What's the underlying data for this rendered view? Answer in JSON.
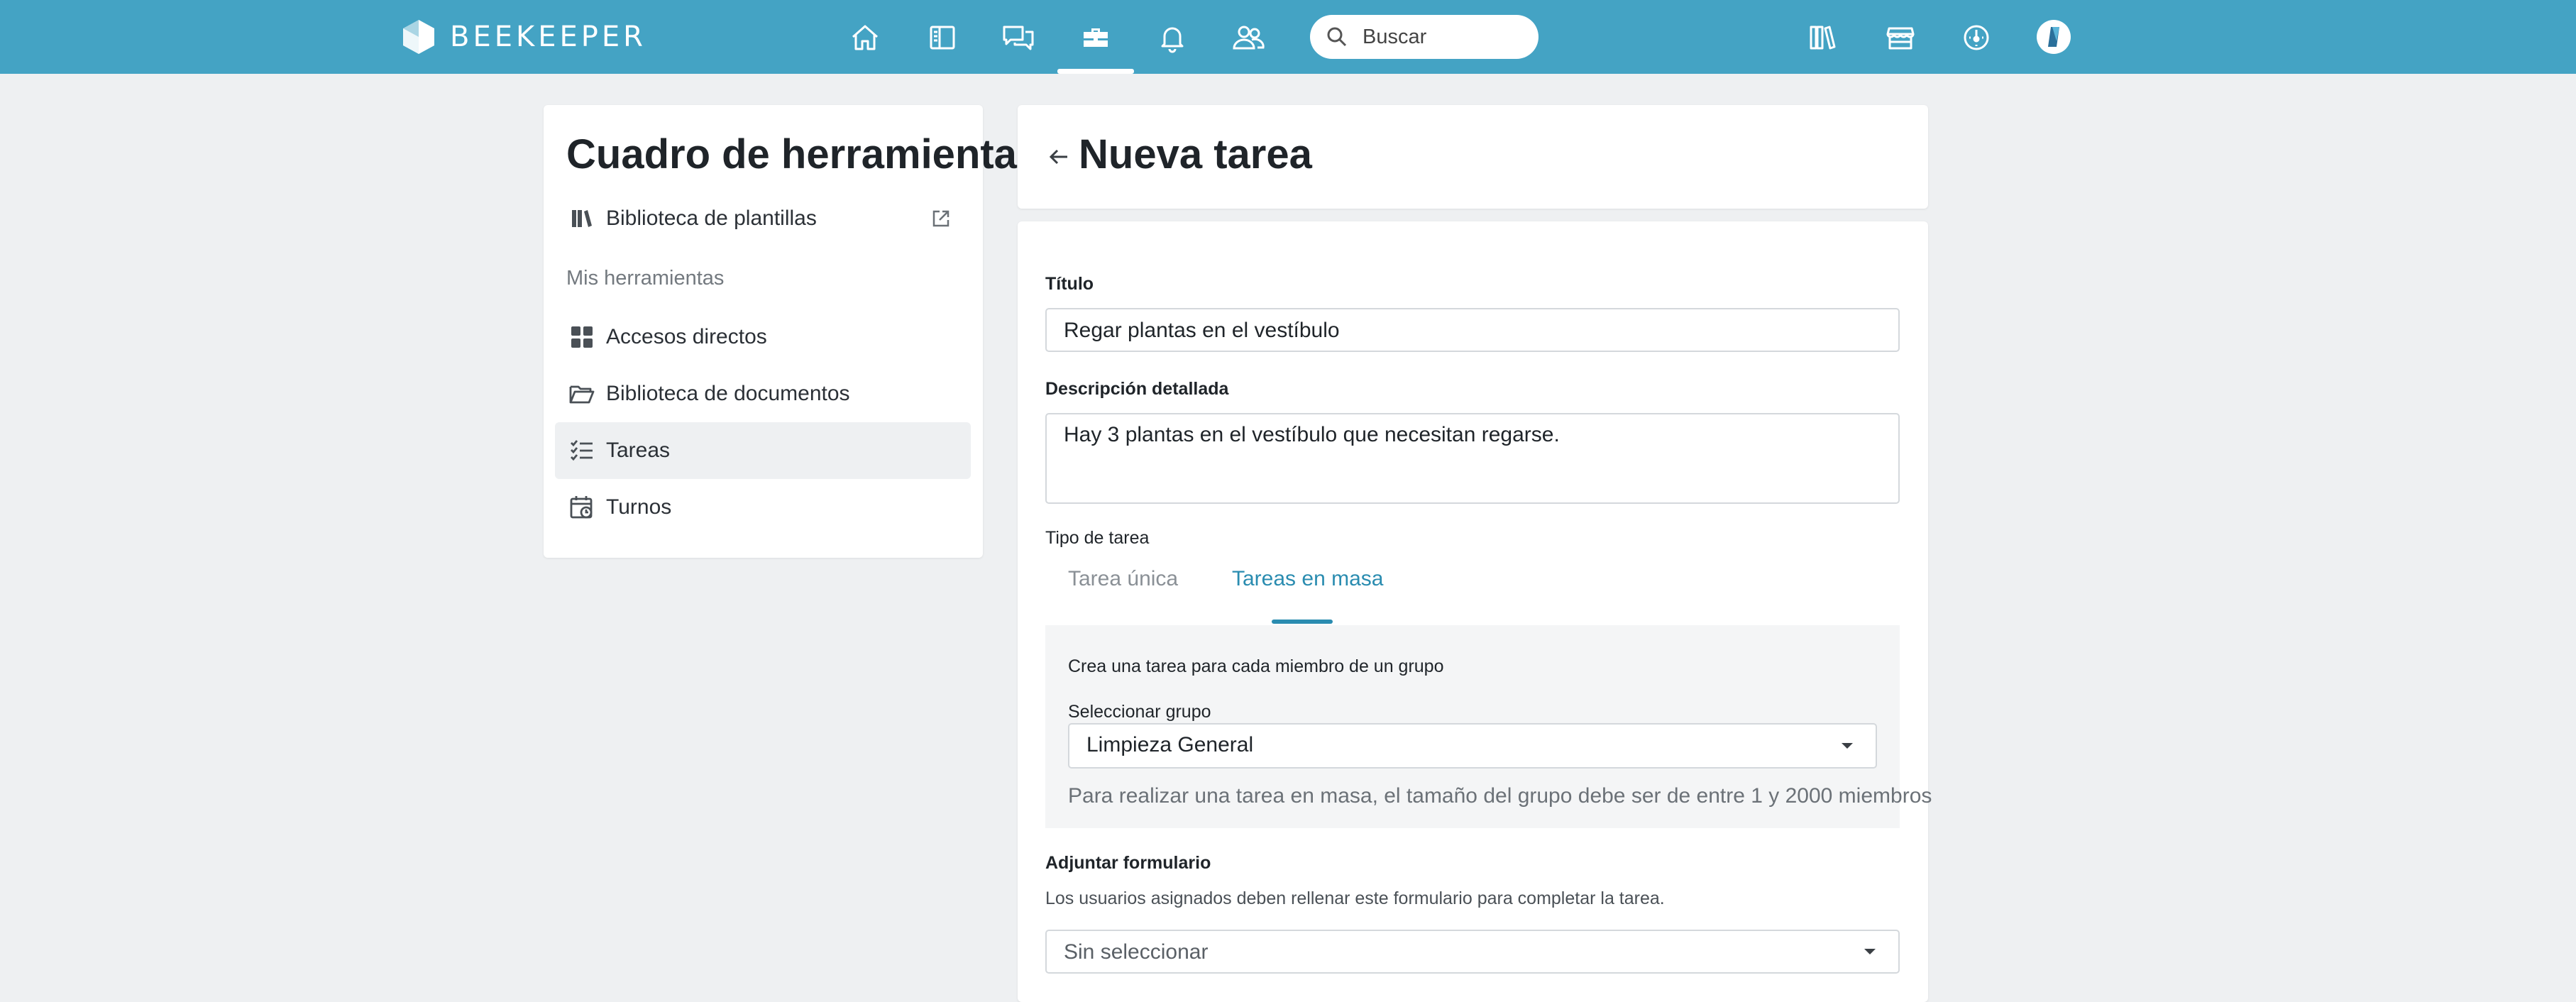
{
  "header": {
    "brand": "BEEKEEPER",
    "search_placeholder": "Buscar",
    "nav_icons": [
      "home-icon",
      "newspaper-icon",
      "chat-icon",
      "toolbox-icon",
      "bell-icon",
      "people-icon"
    ],
    "right_icons": [
      "library-icon",
      "store-icon",
      "dashboard-icon",
      "avatar"
    ]
  },
  "sidebar": {
    "title": "Cuadro de herramientas",
    "template_library": "Biblioteca de plantillas",
    "section_label": "Mis herramientas",
    "items": [
      {
        "label": "Accesos directos",
        "icon": "grid-icon"
      },
      {
        "label": "Biblioteca de documentos",
        "icon": "folder-icon"
      },
      {
        "label": "Tareas",
        "icon": "checklist-icon",
        "active": true
      },
      {
        "label": "Turnos",
        "icon": "calendar-icon"
      }
    ]
  },
  "page": {
    "title": "Nueva tarea"
  },
  "form": {
    "title_label": "Título",
    "title_value": "Regar plantas en el vestíbulo",
    "description_label": "Descripción detallada",
    "description_value": "Hay 3 plantas en el vestíbulo que necesitan regarse.",
    "task_type_label": "Tipo de tarea",
    "tabs": [
      "Tarea única",
      "Tareas en masa"
    ],
    "active_tab": "Tareas en masa",
    "mass": {
      "description": "Crea una tarea para cada miembro de un grupo",
      "select_label": "Seleccionar grupo",
      "selected_group": "Limpieza General",
      "hint": "Para realizar una tarea en masa, el tamaño del grupo debe ser de entre 1 y 2000 miembros"
    },
    "attach_label": "Adjuntar formulario",
    "attach_description": "Los usuarios asignados deben rellenar este formulario para completar la tarea.",
    "attach_value": "Sin seleccionar"
  },
  "colors": {
    "topbar": "#44a3c4",
    "accent": "#2a8cb0",
    "background": "#eef0f2"
  }
}
